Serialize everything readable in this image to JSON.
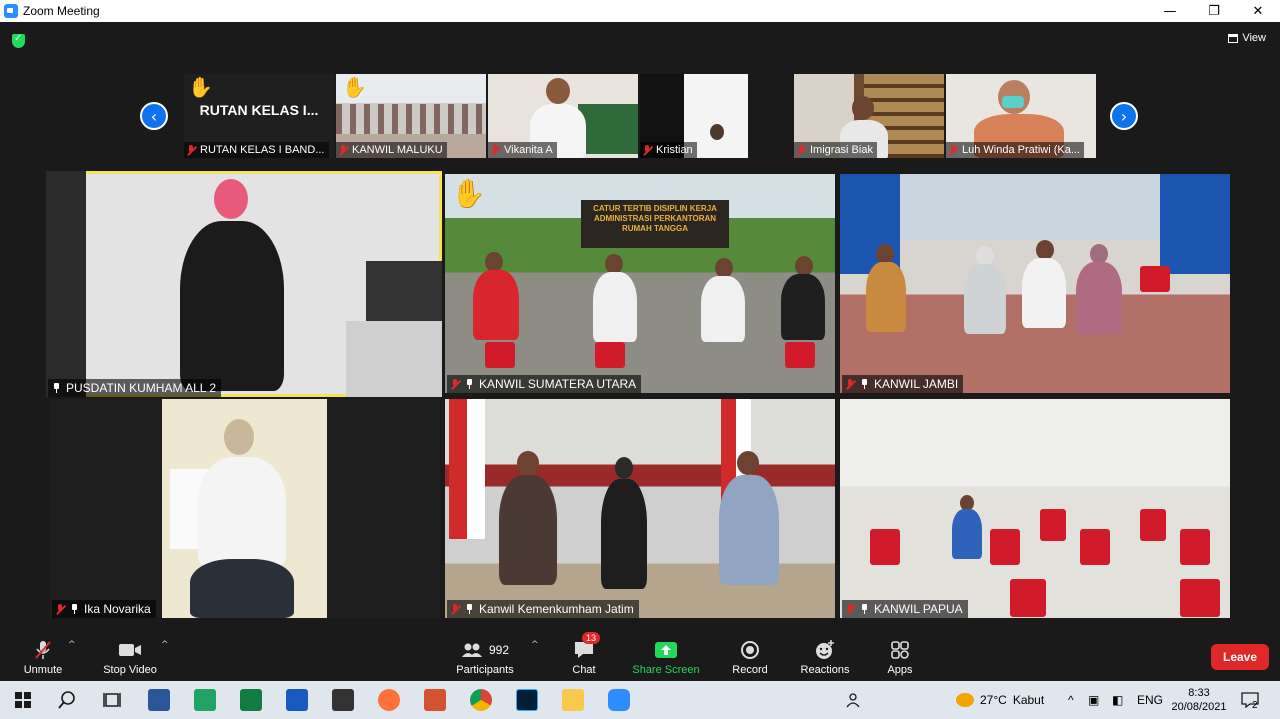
{
  "window": {
    "title": "Zoom Meeting",
    "controls": [
      "—",
      "❐",
      "✕"
    ]
  },
  "top": {
    "view_label": "View"
  },
  "strip": [
    {
      "name": "RUTAN KELAS I BAND...",
      "big": "RUTAN KELAS I...",
      "hand": true
    },
    {
      "name": "KANWIL MALUKU",
      "hand": true
    },
    {
      "name": "Vikanita A",
      "hand": false
    },
    {
      "name": "Kristian",
      "hand": false
    },
    {
      "name": "Imigrasi Biak",
      "hand": false
    },
    {
      "name": "Luh Winda Pratiwi (Ka...",
      "hand": false
    }
  ],
  "gallery": [
    {
      "name": "PUSDATIN KUMHAM ALL 2"
    },
    {
      "name": "KANWIL SUMATERA UTARA"
    },
    {
      "name": "KANWIL JAMBI"
    },
    {
      "name": "Ika Novarika"
    },
    {
      "name": "Kanwil Kemenkumham Jatim"
    },
    {
      "name": "KANWIL PAPUA"
    }
  ],
  "banner_text": "CATUR TERTIB DISIPLIN KERJA ADMINISTRASI PERKANTORAN RUMAH TANGGA",
  "toolbar": {
    "unmute": "Unmute",
    "stop_video": "Stop Video",
    "participants": "Participants",
    "participants_count": "992",
    "chat": "Chat",
    "chat_badge": "13",
    "share_screen": "Share Screen",
    "record": "Record",
    "reactions": "Reactions",
    "apps": "Apps",
    "leave": "Leave"
  },
  "taskbar": {
    "weather_temp": "27°C",
    "weather_text": "Kabut",
    "lang": "ENG",
    "time": "8:33",
    "date": "20/08/2021",
    "notif_count": "2"
  },
  "colors": {
    "accent_blue": "#0e72ed",
    "leave_red": "#e02828",
    "share_green": "#23d959",
    "speaker_yellow": "#f6e05e"
  }
}
